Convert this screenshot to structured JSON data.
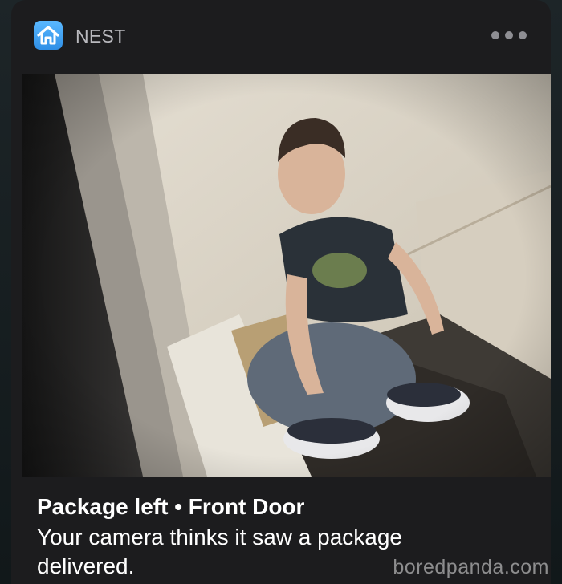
{
  "app": {
    "name": "NEST",
    "icon": "home-icon",
    "accent": "#3fa6f5"
  },
  "notification": {
    "title": "Package left • Front Door",
    "body": "Your camera thinks it saw a package delivered."
  },
  "snapshot": {
    "alt": "Camera snapshot from front door"
  },
  "watermark": "boredpanda.com"
}
